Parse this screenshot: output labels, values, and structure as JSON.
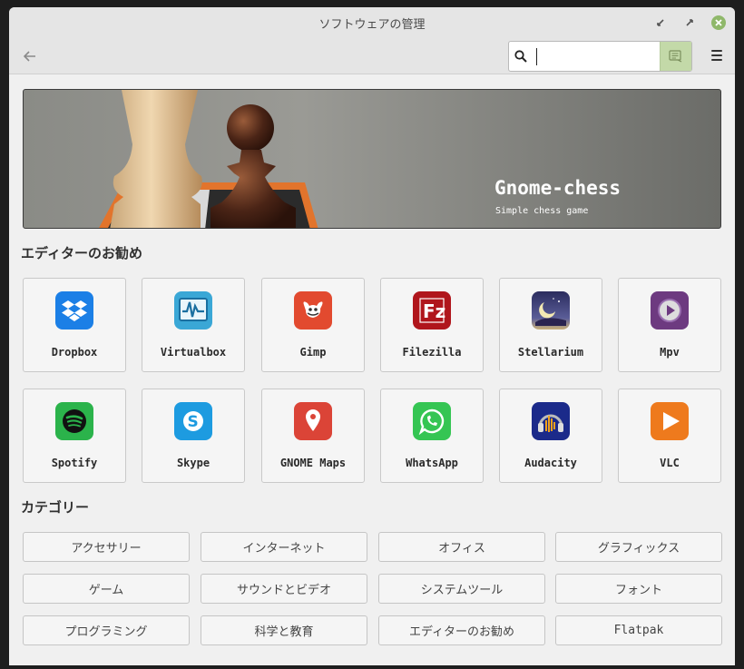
{
  "window": {
    "title": "ソフトウェアの管理"
  },
  "search": {
    "value": "",
    "placeholder": ""
  },
  "banner": {
    "title": "Gnome-chess",
    "subtitle": "Simple chess game"
  },
  "featured": {
    "heading": "エディターのお勧め",
    "apps": [
      {
        "name": "Dropbox",
        "icon": "dropbox-icon",
        "color": "#1b7fe6"
      },
      {
        "name": "Virtualbox",
        "icon": "virtualbox-icon",
        "color": "#3aa7d6"
      },
      {
        "name": "Gimp",
        "icon": "gimp-icon",
        "color": "#e24a2f"
      },
      {
        "name": "Filezilla",
        "icon": "filezilla-icon",
        "color": "#b0161c"
      },
      {
        "name": "Stellarium",
        "icon": "stellarium-icon",
        "color": "#3a3d6e"
      },
      {
        "name": "Mpv",
        "icon": "mpv-icon",
        "color": "#6d3a80"
      },
      {
        "name": "Spotify",
        "icon": "spotify-icon",
        "color": "#2bb34b"
      },
      {
        "name": "Skype",
        "icon": "skype-icon",
        "color": "#1d9be0"
      },
      {
        "name": "GNOME Maps",
        "icon": "maps-pin-icon",
        "color": "#db4437"
      },
      {
        "name": "WhatsApp",
        "icon": "whatsapp-icon",
        "color": "#35c553"
      },
      {
        "name": "Audacity",
        "icon": "audacity-icon",
        "color": "#1b2a8a"
      },
      {
        "name": "VLC",
        "icon": "vlc-icon",
        "color": "#ee7a1d"
      }
    ]
  },
  "categories": {
    "heading": "カテゴリー",
    "items": [
      "アクセサリー",
      "インターネット",
      "オフィス",
      "グラフィックス",
      "ゲーム",
      "サウンドとビデオ",
      "システムツール",
      "フォント",
      "プログラミング",
      "科学と教育",
      "エディターのお勧め",
      "Flatpak"
    ]
  }
}
